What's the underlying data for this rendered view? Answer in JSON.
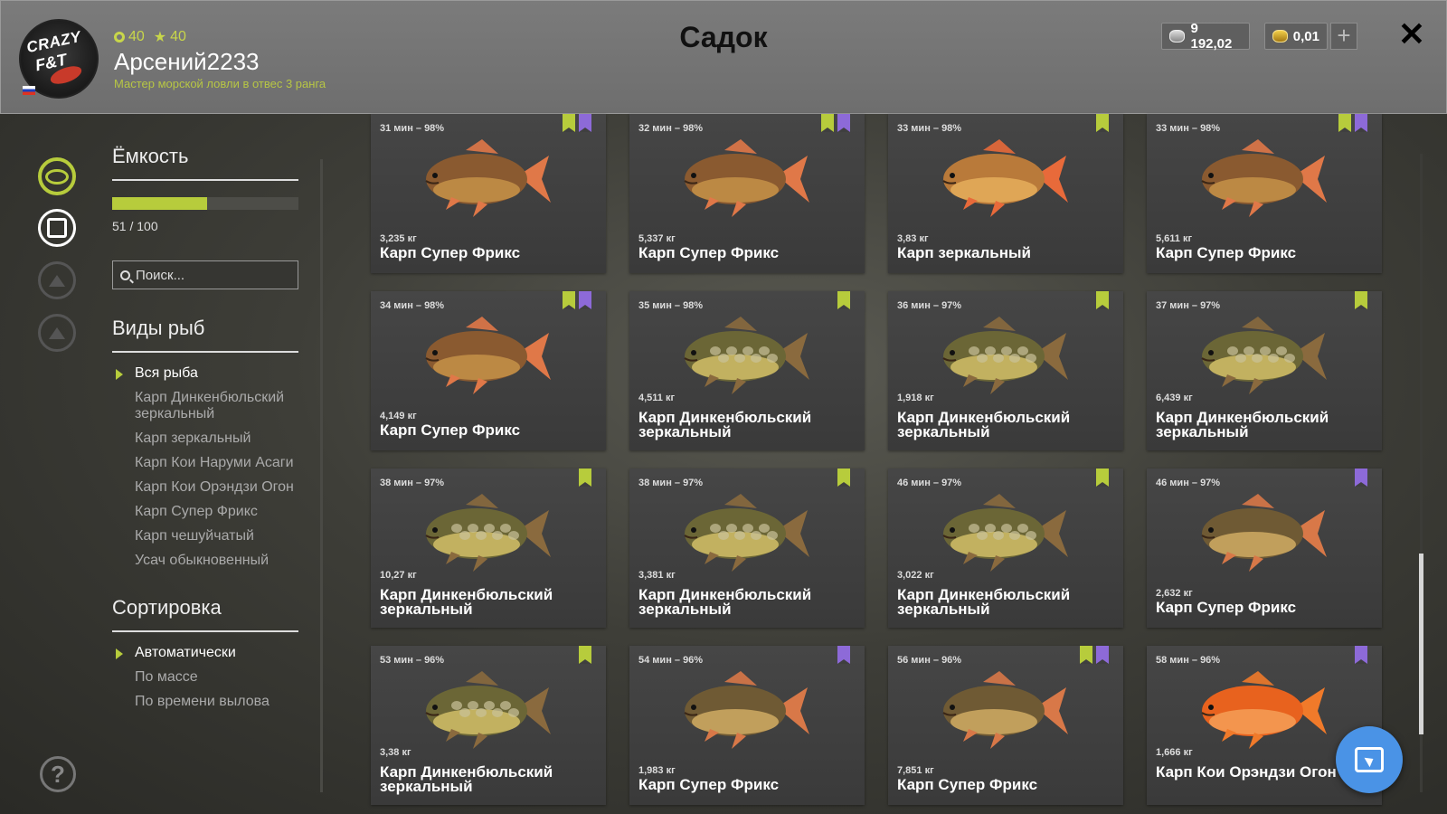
{
  "header": {
    "title": "Садок",
    "player": {
      "name": "Арсений2233",
      "rank": "Мастер морской ловли в отвес 3 ранга",
      "level": "40",
      "stars": "40",
      "logo_text_1": "CRAZY",
      "logo_text_2": "F&T"
    },
    "silver": "9 192,02",
    "gold": "0,01",
    "plus_label": "+",
    "close_label": "✕"
  },
  "nav": {
    "icons": [
      "fish-icon",
      "keepnet-icon",
      "boat-icon",
      "house-icon"
    ],
    "help_label": "?"
  },
  "filters": {
    "capacity_title": "Ёмкость",
    "capacity_value": 51,
    "capacity_max": 100,
    "capacity_text": "51 / 100",
    "search_placeholder": "Поиск...",
    "species_title": "Виды рыб",
    "species": [
      "Вся рыба",
      "Карп Динкенбюльский зеркальный",
      "Карп зеркальный",
      "Карп Кои Наруми Асаги",
      "Карп Кои Орэндзи Огон",
      "Карп Супер Фрикс",
      "Карп чешуйчатый",
      "Усач обыкновенный"
    ],
    "species_active": 0,
    "sort_title": "Сортировка",
    "sort_options": [
      "Автоматически",
      "По массе",
      "По времени вылова"
    ],
    "sort_active": 0
  },
  "colors": {
    "accent_green": "#b7cc3c",
    "accent_purple": "#8d6ad8",
    "gold_text": "#c8d64a",
    "fab_blue": "#4a93e6"
  },
  "fish_cards": [
    {
      "time": "31 мин – 98%",
      "weight": "3,235 кг",
      "name": "Карп Супер Фрикс",
      "marks": [
        "green",
        "purple"
      ],
      "kind": "frix"
    },
    {
      "time": "32 мин – 98%",
      "weight": "5,337 кг",
      "name": "Карп Супер Фрикс",
      "marks": [
        "green",
        "purple"
      ],
      "kind": "frix"
    },
    {
      "time": "33 мин – 98%",
      "weight": "3,83 кг",
      "name": "Карп зеркальный",
      "marks": [
        "green"
      ],
      "kind": "mirror"
    },
    {
      "time": "33 мин – 98%",
      "weight": "5,611 кг",
      "name": "Карп Супер Фрикс",
      "marks": [
        "green",
        "purple"
      ],
      "kind": "frix"
    },
    {
      "time": "34 мин – 98%",
      "weight": "4,149 кг",
      "name": "Карп Супер Фрикс",
      "marks": [
        "green",
        "purple"
      ],
      "kind": "frix"
    },
    {
      "time": "35 мин – 98%",
      "weight": "4,511 кг",
      "name": "Карп Динкенбюльский зеркальный",
      "marks": [
        "green"
      ],
      "kind": "dink"
    },
    {
      "time": "36 мин – 97%",
      "weight": "1,918 кг",
      "name": "Карп Динкенбюльский зеркальный",
      "marks": [
        "green"
      ],
      "kind": "dink"
    },
    {
      "time": "37 мин – 97%",
      "weight": "6,439 кг",
      "name": "Карп Динкенбюльский зеркальный",
      "marks": [
        "green"
      ],
      "kind": "dink"
    },
    {
      "time": "38 мин – 97%",
      "weight": "10,27 кг",
      "name": "Карп Динкенбюльский зеркальный",
      "marks": [
        "green"
      ],
      "kind": "dink"
    },
    {
      "time": "38 мин – 97%",
      "weight": "3,381 кг",
      "name": "Карп Динкенбюльский зеркальный",
      "marks": [
        "green"
      ],
      "kind": "dink"
    },
    {
      "time": "46 мин – 97%",
      "weight": "3,022 кг",
      "name": "Карп Динкенбюльский зеркальный",
      "marks": [
        "green"
      ],
      "kind": "dink"
    },
    {
      "time": "46 мин – 97%",
      "weight": "2,632 кг",
      "name": "Карп Супер Фрикс",
      "marks": [
        "purple"
      ],
      "kind": "frix2"
    },
    {
      "time": "53 мин – 96%",
      "weight": "3,38 кг",
      "name": "Карп Динкенбюльский зеркальный",
      "marks": [
        "green"
      ],
      "kind": "dink"
    },
    {
      "time": "54 мин – 96%",
      "weight": "1,983 кг",
      "name": "Карп Супер Фрикс",
      "marks": [
        "purple"
      ],
      "kind": "frix2"
    },
    {
      "time": "56 мин – 96%",
      "weight": "7,851 кг",
      "name": "Карп Супер Фрикс",
      "marks": [
        "green",
        "purple"
      ],
      "kind": "frix2"
    },
    {
      "time": "58 мин – 96%",
      "weight": "1,666 кг",
      "name": "Карп Кои Орэндзи Огон",
      "marks": [
        "purple"
      ],
      "kind": "koi"
    }
  ]
}
